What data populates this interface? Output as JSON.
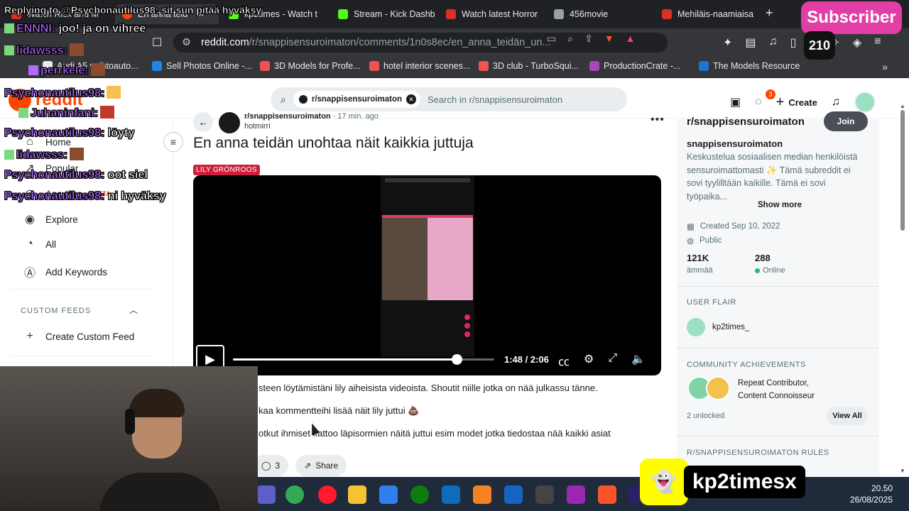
{
  "browser": {
    "tabs": [
      {
        "label": "Watch Rick and M",
        "color": "#d93025"
      },
      {
        "label": "En anna teid",
        "color": "#ff4500",
        "active": true
      },
      {
        "label": "kp2times - Watch t",
        "color": "#53fc18"
      },
      {
        "label": "Stream - Kick Dashb",
        "color": "#53fc18"
      },
      {
        "label": "Watch latest Horror",
        "color": "#d93025"
      },
      {
        "label": "456movie",
        "color": "#9aa0a6"
      },
      {
        "label": "Mehiläis-naamiaisa",
        "color": "#d93025"
      }
    ],
    "url_host": "reddit.com",
    "url_path": "/r/snappisensuroimaton/comments/1n0s8ec/en_anna_teidän_un...",
    "bookmarks": [
      {
        "label": "Audi A5 vaihtoauto...",
        "color": "#e8eaed"
      },
      {
        "label": "Sell Photos Online -...",
        "color": "#1e88e5"
      },
      {
        "label": "3D Models for Profe...",
        "color": "#ef5350"
      },
      {
        "label": "hotel interior scenes...",
        "color": "#ef5350"
      },
      {
        "label": "3D club - TurboSqui...",
        "color": "#ef5350"
      },
      {
        "label": "ProductionCrate -...",
        "color": "#ab47bc"
      },
      {
        "label": "The Models Resource",
        "color": "#1976d2"
      }
    ]
  },
  "reddit": {
    "logo_text": "reddit",
    "search_chip": "r/snappisensuroimaton",
    "search_placeholder": "Search in r/snappisensuroimaton",
    "create_label": "Create",
    "notification_count": "3"
  },
  "sidebar": {
    "items": [
      {
        "label": "Home",
        "icon": "home-icon",
        "glyph": "⌂"
      },
      {
        "label": "Popular",
        "icon": "popular-icon",
        "glyph": "↗"
      },
      {
        "label": "Answers",
        "icon": "answers-icon",
        "glyph": "◎",
        "beta": "BETA"
      },
      {
        "label": "Explore",
        "icon": "explore-icon",
        "glyph": "◉"
      },
      {
        "label": "All",
        "icon": "all-icon",
        "glyph": "◔"
      },
      {
        "label": "Add Keywords",
        "icon": "keywords-icon",
        "glyph": "Ⓐ"
      }
    ],
    "custom_feeds_heading": "CUSTOM FEEDS",
    "create_custom_feed": "Create Custom Feed"
  },
  "post": {
    "subreddit": "r/snappisensuroimaton",
    "time": "17 min. ago",
    "author": "hotmirri",
    "title": "En anna teidän unohtaa näit kaikkia juttuja",
    "flair": "LILY GRÖNROOS",
    "video_time": "1:48 / 2:06",
    "video_progress": 0.857,
    "body": [
      "steen löytämistäni lily aiheisista videoista. Shoutit niille jotka on nää julkassu tänne.",
      "kaa kommentteihi lisää näit lily juttui 💩",
      "otkut ihmiset kattoo läpisormien näitä juttui esim modet jotka tiedostaa nää kaikki asiat"
    ],
    "comment_count": "3",
    "share_label": "Share"
  },
  "community": {
    "title": "r/snappisensuroimaton",
    "join_label": "Join",
    "name": "snappisensuroimaton",
    "description": "Keskustelua sosiaalisen median henkilöistä sensuroimattomasti ✨ Tämä subreddit ei sovi tyylilltään kaikille. Tämä ei sovi työpaika...",
    "show_more": "Show more",
    "created": "Created Sep 10, 2022",
    "visibility": "Public",
    "members": "121K",
    "members_label": "ämmää",
    "online": "288",
    "online_label": "Online",
    "user_flair_heading": "USER FLAIR",
    "user_flair_name": "kp2times_",
    "achievements_heading": "COMMUNITY ACHIEVEMENTS",
    "achievements": "Repeat Contributor,",
    "achievements_2": "Content Connoisseur",
    "unlocked": "2 unlocked",
    "view_all": "View All",
    "rules_heading": "R/SNAPPISENSUROIMATON RULES"
  },
  "stream_overlay": {
    "chat": [
      {
        "name": "",
        "text": "Replying to @Psychonautilus98: sit sun pitää hyväksy"
      },
      {
        "name": "ENNNI:",
        "text": "joo! ja on vihree"
      },
      {
        "name": "lidawsss:",
        "text": ""
      },
      {
        "name": "perrkele:",
        "text": ""
      },
      {
        "name": "Psychonautilus98:",
        "text": ""
      },
      {
        "name": "Juhaninfani:",
        "text": ""
      },
      {
        "name": "Psychonautilus98:",
        "text": "löyty"
      },
      {
        "name": "lidawsss:",
        "text": ""
      },
      {
        "name": "Psychonautilus98:",
        "text": "oot siel"
      },
      {
        "name": "Psychonautilus98:",
        "text": "ni hyväksy"
      }
    ],
    "subscriber_label": "Subscriber",
    "counter": "210",
    "snapchat_handle": "kp2timesx"
  },
  "taskbar": {
    "time": "20.50",
    "date": "26/08/2025"
  }
}
